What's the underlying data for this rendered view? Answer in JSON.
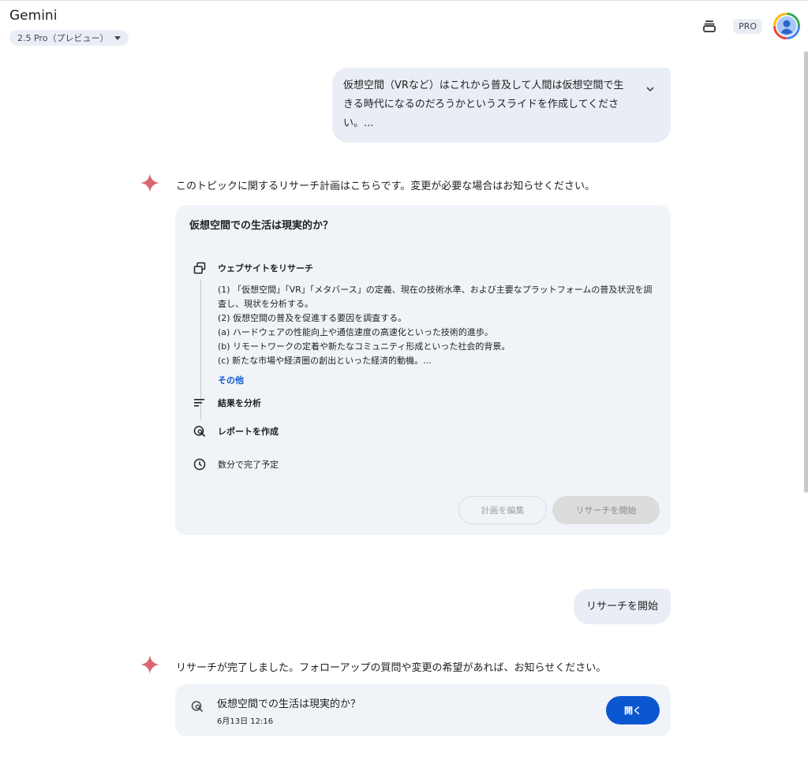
{
  "header": {
    "app_title": "Gemini",
    "model_label": "2.5 Pro（プレビュー）",
    "pro_badge": "PRO"
  },
  "conversation": {
    "user_prompt": "仮想空間（VRなど）はこれから普及して人間は仮想空間で生きる時代になるのだろうかというスライドを作成してください。...",
    "response_intro": "このトピックに関するリサーチ計画はこちらです。変更が必要な場合はお知らせください。",
    "plan": {
      "title": "仮想空間での生活は現実的か？",
      "step_research_label": "ウェブサイトをリサーチ",
      "details": [
        "(1) 「仮想空間」「VR」「メタバース」の定義、現在の技術水準、および主要なプラットフォームの普及状況を調査し、現状を分析する。",
        "(2) 仮想空間の普及を促進する要因を調査する。",
        "(a) ハードウェアの性能向上や通信速度の高速化といった技術的進歩。",
        "(b) リモートワークの定着や新たなコミュニティ形成といった社会的背景。",
        "(c) 新たな市場や経済圏の創出といった経済的動機。..."
      ],
      "more_label": "その他",
      "step_analyze_label": "結果を分析",
      "step_report_label": "レポートを作成",
      "eta_label": "数分で完了予定",
      "edit_button": "計画を編集",
      "start_button": "リサーチを開始"
    },
    "user_reply": "リサーチを開始",
    "response_done": "リサーチが完了しました。フォローアップの質問や変更の希望があれば、お知らせください。",
    "report": {
      "title": "仮想空間での生活は現実的か？",
      "date": "6月13日 12:16",
      "open_button": "開く"
    }
  },
  "colors": {
    "accent_blue": "#0b57d0",
    "bubble_bg": "#e9eef6",
    "card_bg": "#f0f4f9",
    "sparkle": "#d96570"
  },
  "icons": [
    "history-icon",
    "avatar-icon",
    "chevron-down-icon",
    "gemini-sparkle-icon",
    "web-pages-icon",
    "analyze-lines-icon",
    "report-search-icon",
    "clock-icon"
  ]
}
